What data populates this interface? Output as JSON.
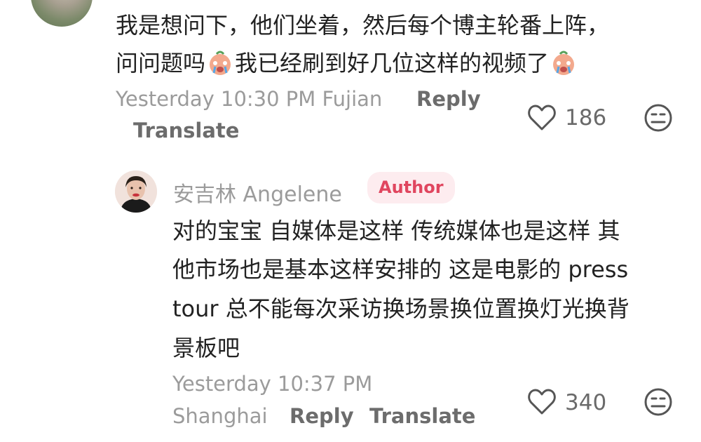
{
  "comment": {
    "line1": "我是想问下，他们坐着，然后每个博主轮番上阵，",
    "line2_part1": "问问题吗",
    "line2_part2": "我已经刷到好几位这样的视频了",
    "timestamp": "Yesterday 10:30 PM",
    "location": "Fujian",
    "reply_label": "Reply",
    "translate_label": "Translate",
    "likes": "186"
  },
  "reply": {
    "author": "安吉林 Angelene",
    "badge": "Author",
    "lines": [
      "对的宝宝 自媒体是这样 传统媒体也是这样 其",
      "他市场也是基本这样安排的 这是电影的 press",
      "tour 总不能每次采访换场景换位置换灯光换背",
      "景板吧"
    ],
    "timestamp": "Yesterday 10:37 PM",
    "location": "Shanghai",
    "reply_label": "Reply",
    "translate_label": "Translate",
    "likes": "340"
  },
  "icons": {
    "like": "heart-outline-icon",
    "dislike": "neutral-face-icon",
    "emoji": "crying-face-emoji"
  }
}
